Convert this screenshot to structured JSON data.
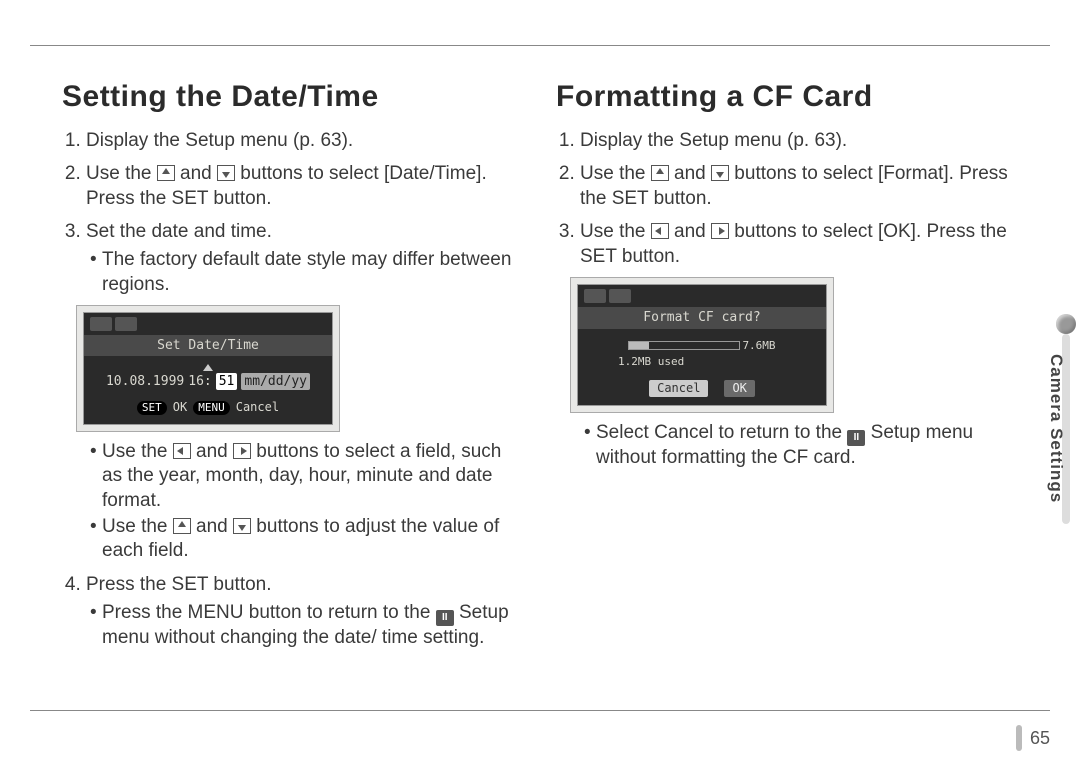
{
  "page_number": "65",
  "side_label": "Camera Settings",
  "left": {
    "heading": "Setting the Date/Time",
    "step1": "Display the Setup menu (p. 63).",
    "step2_a": "Use the ",
    "step2_b": " and ",
    "step2_c": " buttons to select [Date/Time]. Press the SET button.",
    "step3": "Set the date and time.",
    "step3_sub1": "The factory default date style may differ between regions.",
    "step3_sub2_a": "Use the ",
    "step3_sub2_b": " and ",
    "step3_sub2_c": " buttons to select a field, such as the year, month, day, hour, minute and date format.",
    "step3_sub3_a": "Use the ",
    "step3_sub3_b": " and ",
    "step3_sub3_c": " buttons to adjust the value of each field.",
    "step4": "Press the SET button.",
    "step4_sub1_a": "Press the MENU button to return to the ",
    "step4_sub1_b": " Setup menu without changing the date/ time setting.",
    "lcd": {
      "title": "Set Date/Time",
      "date": "10.08.1999",
      "time_pre": "16:",
      "time_sel": "51",
      "fmt": "mm/dd/yy",
      "set": "SET",
      "ok": "OK",
      "menu": "MENU",
      "cancel": "Cancel"
    }
  },
  "right": {
    "heading": "Formatting a CF Card",
    "step1": "Display the Setup menu (p. 63).",
    "step2_a": "Use the ",
    "step2_b": " and ",
    "step2_c": " buttons to select [Format]. Press the SET button.",
    "step3_a": "Use the ",
    "step3_b": " and ",
    "step3_c": " buttons to select [OK]. Press the SET button.",
    "note_a": "Select Cancel to return to the ",
    "note_b": " Setup menu without formatting the CF card.",
    "lcd": {
      "title": "Format CF card?",
      "total": "7.6MB",
      "used": "1.2MB used",
      "cancel": "Cancel",
      "ok": "OK"
    }
  }
}
